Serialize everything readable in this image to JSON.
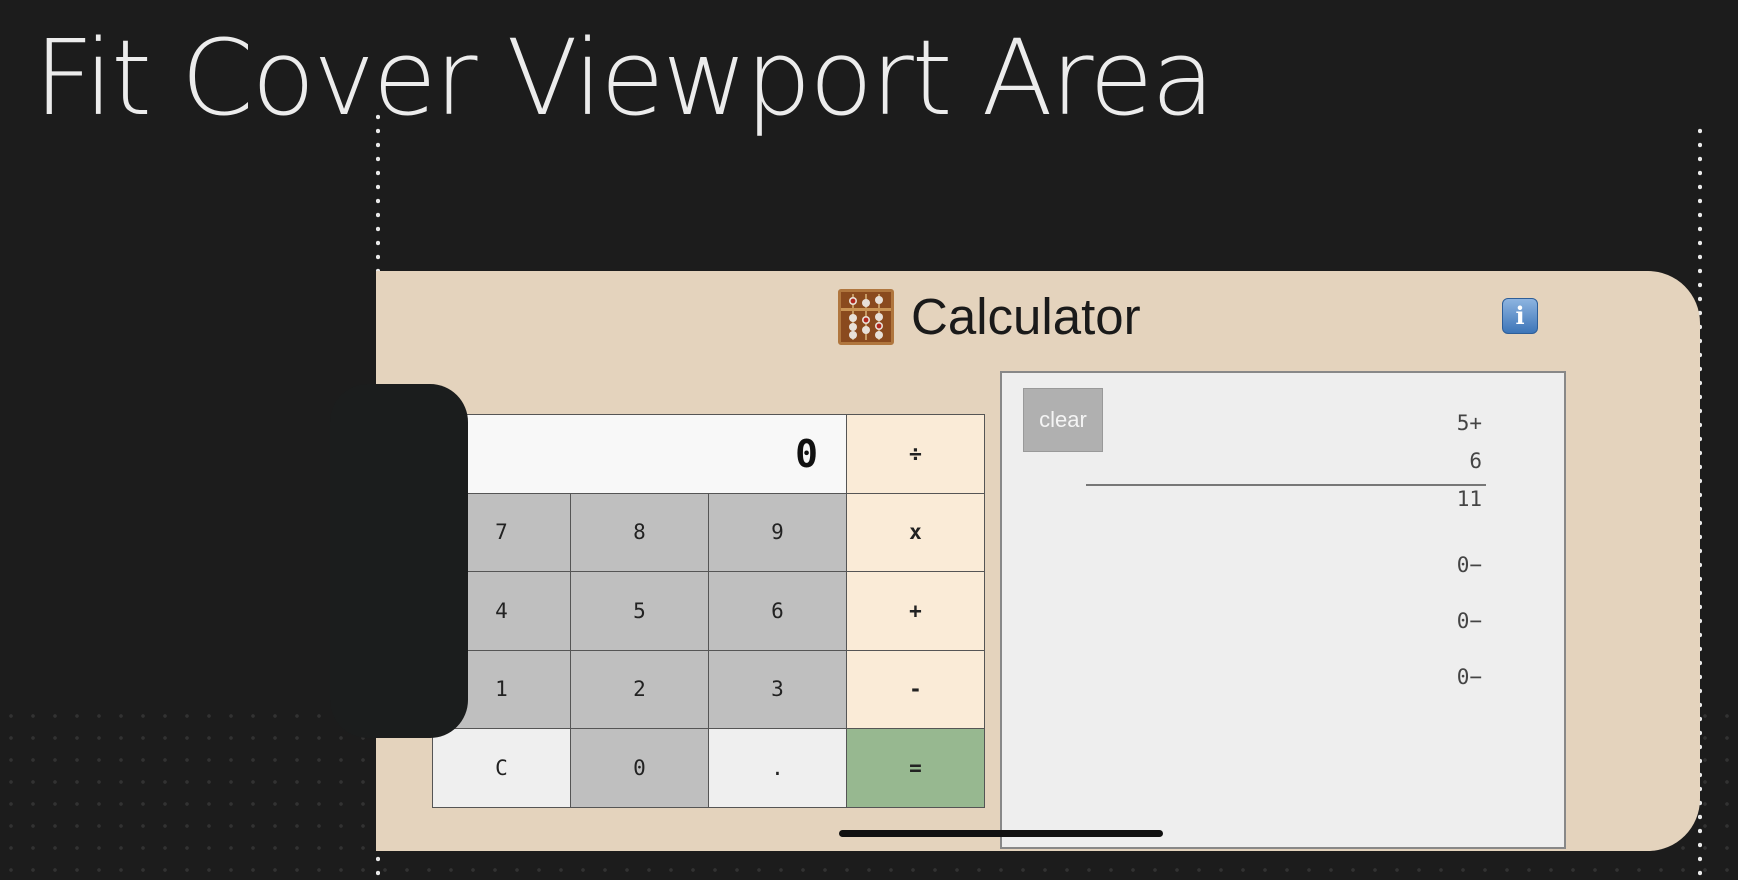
{
  "page": {
    "title": "Fit Cover Viewport Area"
  },
  "app": {
    "title": "Calculator",
    "info_label": "i",
    "colors": {
      "background": "#e4d3bd",
      "digit_key": "#bfbfbf",
      "operator_key": "#faebd7",
      "equals_key": "#97b890"
    }
  },
  "calculator": {
    "display": "0",
    "keys": {
      "divide": "÷",
      "multiply": "x",
      "plus": "+",
      "minus": "-",
      "equals": "=",
      "clear": "C",
      "decimal": ".",
      "d0": "0",
      "d1": "1",
      "d2": "2",
      "d3": "3",
      "d4": "4",
      "d5": "5",
      "d6": "6",
      "d7": "7",
      "d8": "8",
      "d9": "9"
    }
  },
  "tape": {
    "clear_label": "clear",
    "lines": [
      "5+",
      "6",
      "11",
      "0−",
      "0−",
      "0−"
    ]
  }
}
